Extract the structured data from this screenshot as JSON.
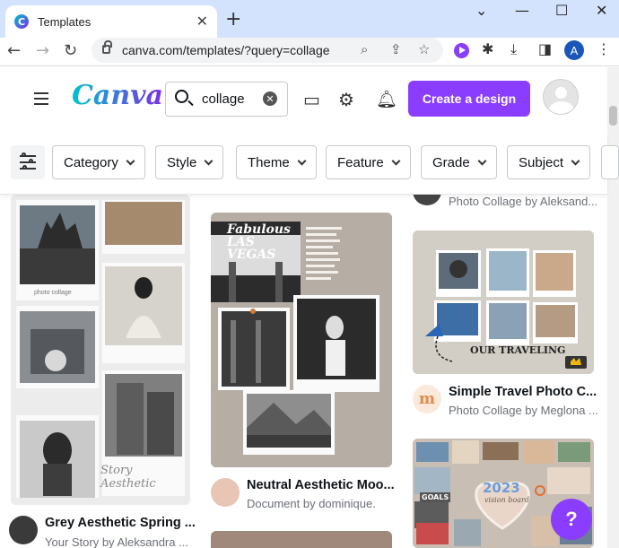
{
  "browser": {
    "tab_title": "Templates",
    "tab_close": "✕",
    "new_tab": "+",
    "url": "canva.com/templates/?query=collage",
    "profile_initial": "A",
    "window_controls": [
      "⌄",
      "—",
      "☐",
      "✕"
    ]
  },
  "header": {
    "logo": "Canva",
    "search_value": "collage",
    "create_label": "Create a design"
  },
  "filters": [
    "Category",
    "Style",
    "Theme",
    "Feature",
    "Grade",
    "Subject"
  ],
  "templates": [
    {
      "title": "Grey Aesthetic Spring ...",
      "subtitle": "Your Story by Aleksandra ...",
      "photo_caption": "photo collage",
      "signature": "Story Aesthetic"
    },
    {
      "title": "Neutral Aesthetic Moo...",
      "subtitle": "Document by dominique.",
      "poster_title": "Fabulous LAS VEGAS"
    },
    {
      "title": "",
      "subtitle": "Photo Collage by Aleksand..."
    },
    {
      "title": "Simple Travel Photo C...",
      "subtitle": "Photo Collage by Meglona ...",
      "banner": "OUR TRAVELING",
      "monogram": "m"
    },
    {
      "badge": "2023",
      "badge_sub": "vision board",
      "label": "GOALS"
    }
  ],
  "help_label": "?",
  "colors": {
    "accent": "#8b3dff",
    "tabbar": "#d3e3fd"
  }
}
